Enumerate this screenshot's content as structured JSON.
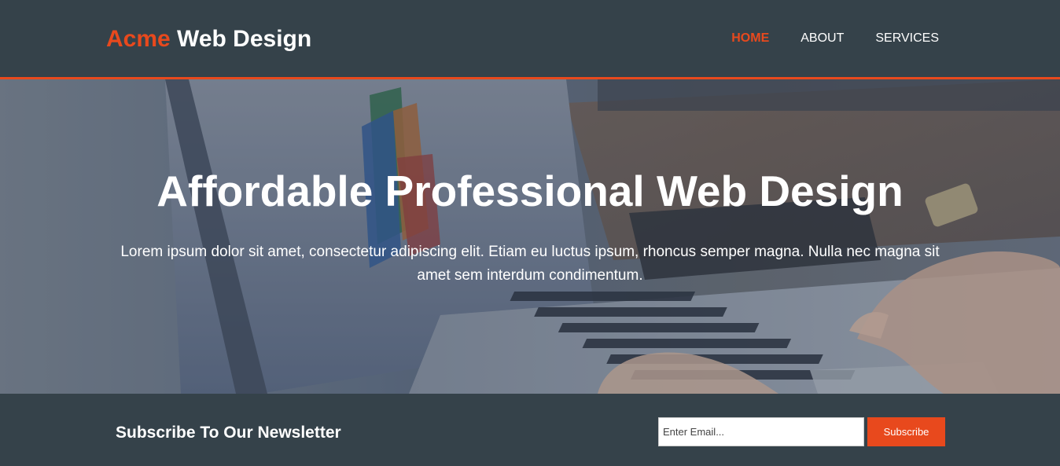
{
  "brand": {
    "accent": "Acme",
    "rest": " Web Design"
  },
  "nav": {
    "items": [
      {
        "label": "HOME",
        "active": true
      },
      {
        "label": "ABOUT",
        "active": false
      },
      {
        "label": "SERVICES",
        "active": false
      }
    ]
  },
  "showcase": {
    "title": "Affordable Professional Web Design",
    "text": "Lorem ipsum dolor sit amet, consectetur adipiscing elit. Etiam eu luctus ipsum, rhoncus semper magna. Nulla nec magna sit amet sem interdum condimentum."
  },
  "newsletter": {
    "heading": "Subscribe To Our Newsletter",
    "email_placeholder": "Enter Email...",
    "email_value": "",
    "button_label": "Subscribe"
  },
  "colors": {
    "dark": "#35424a",
    "accent": "#e8491d",
    "text": "#ffffff"
  }
}
